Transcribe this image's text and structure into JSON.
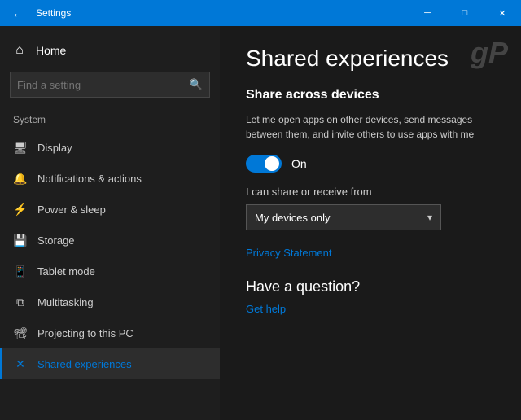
{
  "titlebar": {
    "back_label": "←",
    "title": "Settings",
    "btn_minimize": "─",
    "btn_maximize": "□",
    "btn_close": "✕"
  },
  "sidebar": {
    "home_label": "Home",
    "home_icon": "⌂",
    "search_placeholder": "Find a setting",
    "search_icon": "🔍",
    "system_label": "System",
    "nav_items": [
      {
        "icon": "🖥",
        "label": "Display"
      },
      {
        "icon": "🔔",
        "label": "Notifications & actions"
      },
      {
        "icon": "⚡",
        "label": "Power & sleep"
      },
      {
        "icon": "💾",
        "label": "Storage"
      },
      {
        "icon": "📱",
        "label": "Tablet mode"
      },
      {
        "icon": "⧉",
        "label": "Multitasking"
      },
      {
        "icon": "📽",
        "label": "Projecting to this PC"
      },
      {
        "icon": "✕",
        "label": "Shared experiences",
        "active": true
      }
    ]
  },
  "content": {
    "watermark": "gP",
    "page_title": "Shared experiences",
    "section_title": "Share across devices",
    "section_desc": "Let me open apps on other devices, send messages between them, and invite others to use apps with me",
    "toggle_state": "On",
    "share_receive_label": "I can share or receive from",
    "dropdown_value": "My devices only",
    "privacy_link": "Privacy Statement",
    "question_title": "Have a question?",
    "help_link": "Get help"
  }
}
